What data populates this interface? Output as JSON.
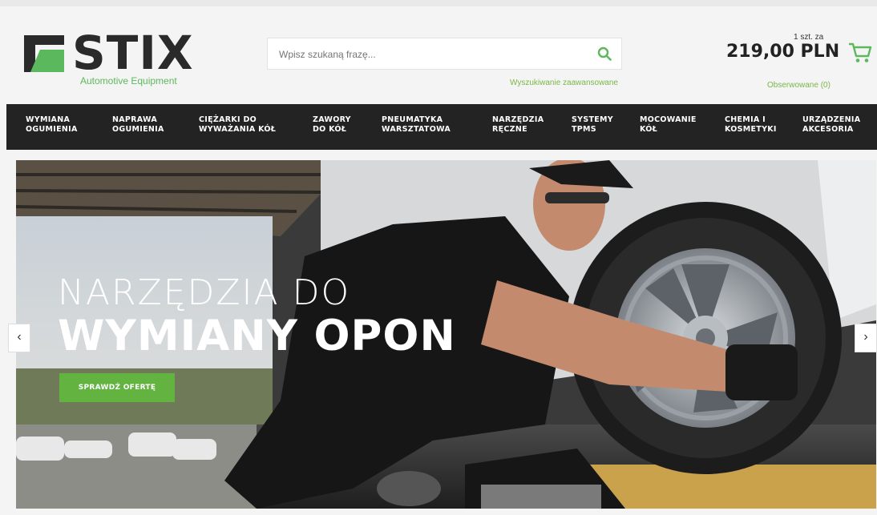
{
  "brand": {
    "name": "STIX",
    "tagline": "Automotive Equipment",
    "colors": {
      "green": "#5cb85c",
      "dark": "#2a2a2a"
    }
  },
  "search": {
    "placeholder": "Wpisz szukaną frazę...",
    "advanced_label": "Wyszukiwanie zaawansowane"
  },
  "cart": {
    "qty_label": "1 szt. za",
    "price": "219,00 PLN",
    "watched_label": "Obserwowane (0)"
  },
  "nav": {
    "items": [
      {
        "label": "WYMIANA\nOGUMIENIA"
      },
      {
        "label": "NAPRAWA\nOGUMIENIA"
      },
      {
        "label": "CIĘŻARKI DO\nWYWAŻANIA KÓŁ"
      },
      {
        "label": "ZAWORY\nDO KÓŁ"
      },
      {
        "label": "PNEUMATYKA\nWARSZTATOWA"
      },
      {
        "label": "NARZĘDZIA\nRĘCZNE"
      },
      {
        "label": "SYSTEMY\nTPMS"
      },
      {
        "label": "MOCOWANIE\nKÓŁ"
      },
      {
        "label": "CHEMIA I\nKOSMETYKI"
      },
      {
        "label": "URZĄDZENIA\nAKCESORIA"
      }
    ]
  },
  "hero": {
    "line1": "NARZĘDZIA DO",
    "line2": "WYMIANY OPON",
    "button": "SPRAWDŹ OFERTĘ"
  },
  "slider": {
    "prev": "‹",
    "next": "›"
  }
}
